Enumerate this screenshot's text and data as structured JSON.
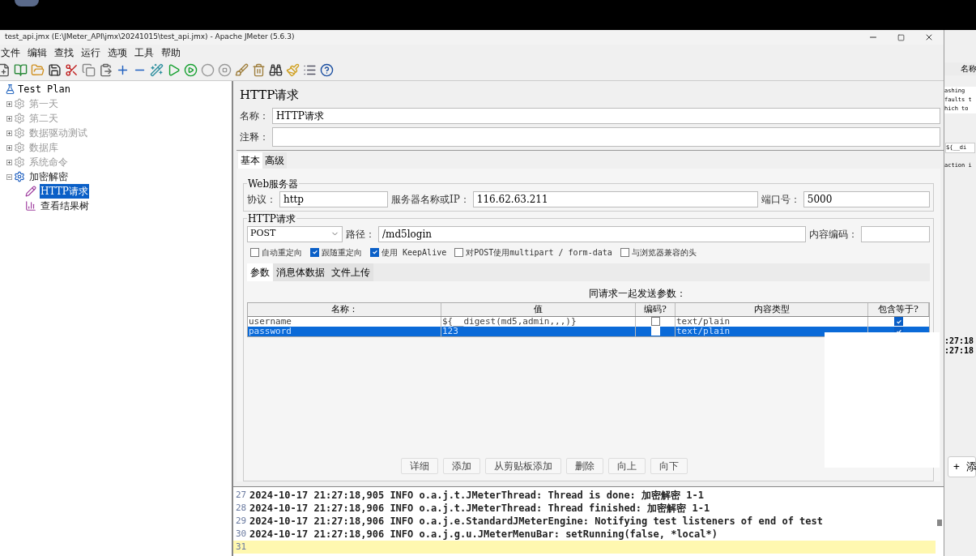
{
  "window": {
    "title": "test_api.jmx (E:\\JMeter_API\\jmx\\20241015\\test_api.jmx) - Apache JMeter (5.6.3)"
  },
  "menu": [
    "文件",
    "编辑",
    "查找",
    "运行",
    "选项",
    "工具",
    "帮助"
  ],
  "tree": {
    "label": "Test Plan",
    "children": [
      {
        "label": "第一天",
        "enabled": false,
        "expanded": false,
        "selected": false
      },
      {
        "label": "第二天",
        "enabled": false,
        "expanded": false,
        "selected": false
      },
      {
        "label": "数据驱动测试",
        "enabled": false,
        "expanded": false,
        "selected": false
      },
      {
        "label": "数据库",
        "enabled": false,
        "expanded": false,
        "selected": false
      },
      {
        "label": "系统命令",
        "enabled": false,
        "expanded": false,
        "selected": false
      },
      {
        "label": "加密解密",
        "enabled": true,
        "expanded": true,
        "selected": false,
        "children": [
          {
            "label": "HTTP请求",
            "kind": "sampler",
            "selected": true
          },
          {
            "label": "查看结果树",
            "kind": "listener",
            "selected": false
          }
        ]
      }
    ]
  },
  "panel": {
    "title": "HTTP请求",
    "name_label": "名称：",
    "name_value": "HTTP请求",
    "comment_label": "注释："
  },
  "tabs": [
    {
      "label": "基本",
      "selected": true
    },
    {
      "label": "高级",
      "selected": false
    }
  ],
  "web_server": {
    "legend": "Web服务器",
    "protocol_label": "协议：",
    "protocol": "http",
    "server_label": "服务器名称或IP：",
    "server": "116.62.63.211",
    "port_label": "端口号：",
    "port": "5000"
  },
  "http_request": {
    "legend": "HTTP请求",
    "method": "POST",
    "path_label": "路径：",
    "path": "/md5login",
    "encoding_label": "内容编码："
  },
  "options": [
    {
      "label": "自动重定向",
      "checked": false
    },
    {
      "label": "跟随重定向",
      "checked": true
    },
    {
      "label": "使用 KeepAlive",
      "checked": true
    },
    {
      "label": "对POST使用multipart / form-data",
      "checked": false
    },
    {
      "label": "与浏览器兼容的头",
      "checked": false
    }
  ],
  "param_tabs": [
    {
      "label": "参数",
      "selected": true
    },
    {
      "label": "消息体数据",
      "selected": false
    },
    {
      "label": "文件上传",
      "selected": false
    }
  ],
  "params": {
    "caption": "同请求一起发送参数：",
    "columns": [
      "名称：",
      "值",
      "编码?",
      "内容类型",
      "包含等于?"
    ],
    "rows": [
      {
        "name": "username",
        "value": "${__digest(md5,admin,,,)}",
        "encode": false,
        "content_type": "text/plain",
        "include_equals": true,
        "selected": false
      },
      {
        "name": "password",
        "value": "123",
        "encode": false,
        "content_type": "text/plain",
        "include_equals": true,
        "selected": true
      }
    ]
  },
  "buttons": [
    "详细",
    "添加",
    "从剪贴板添加",
    "删除",
    "向上",
    "向下"
  ],
  "log": [
    {
      "line": "27",
      "text": "2024-10-17 21:27:18,905 INFO o.a.j.t.JMeterThread: Thread is done: 加密解密 1-1",
      "current": false
    },
    {
      "line": "28",
      "text": "2024-10-17 21:27:18,906 INFO o.a.j.t.JMeterThread: Thread finished: 加密解密 1-1",
      "current": false
    },
    {
      "line": "29",
      "text": "2024-10-17 21:27:18,906 INFO o.a.j.e.StandardJMeterEngine: Notifying test listeners of end of test",
      "current": false
    },
    {
      "line": "30",
      "text": "2024-10-17 21:27:18,906 INFO o.a.j.g.u.JMeterMenuBar: setRunning(false, *local*)",
      "current": false
    },
    {
      "line": "31",
      "current": true
    }
  ],
  "background_window": {
    "header": "名称",
    "lines": [
      "ashing",
      "faults t",
      "hich to"
    ],
    "field": "${__di",
    "note": "action i",
    "times": [
      ":27:18",
      ":27:18"
    ],
    "button": "+ 添"
  }
}
